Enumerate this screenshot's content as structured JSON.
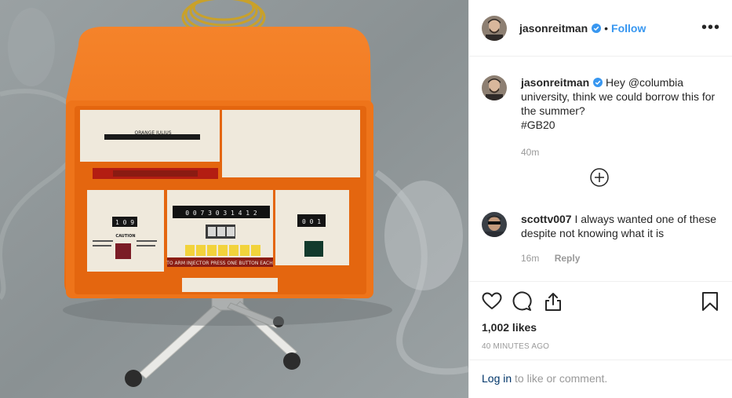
{
  "post": {
    "author": "jasonreitman",
    "follow_label": "Follow",
    "separator": "•",
    "more_label": "•••"
  },
  "caption": {
    "username": "jasonreitman",
    "text": "Hey @columbia university, think we could borrow this for the summer?",
    "hashtag": "#GB20",
    "time": "40m"
  },
  "comments": [
    {
      "username": "scottv007",
      "text": "I always wanted one of these despite not knowing what it is",
      "time": "16m",
      "reply_label": "Reply"
    }
  ],
  "actions": {
    "likes": "1,002 likes",
    "time_ago": "40 MINUTES AGO"
  },
  "login": {
    "link_label": "Log in",
    "rest": "to like or comment."
  },
  "image": {
    "device_nameplate": "ORANGE JULIUS",
    "display_digits": "0 0 7 3 0 3 1 4 1 2",
    "counter_left": "1 0 9",
    "counter_right": "0 0 1",
    "caution_label": "CAUTION",
    "strip_text": "TO ARM INJECTOR PRESS ONE BUTTON EACH"
  },
  "colors": {
    "accent": "#3897f0",
    "device_orange": "#f07a1e",
    "text_muted": "#999999"
  }
}
